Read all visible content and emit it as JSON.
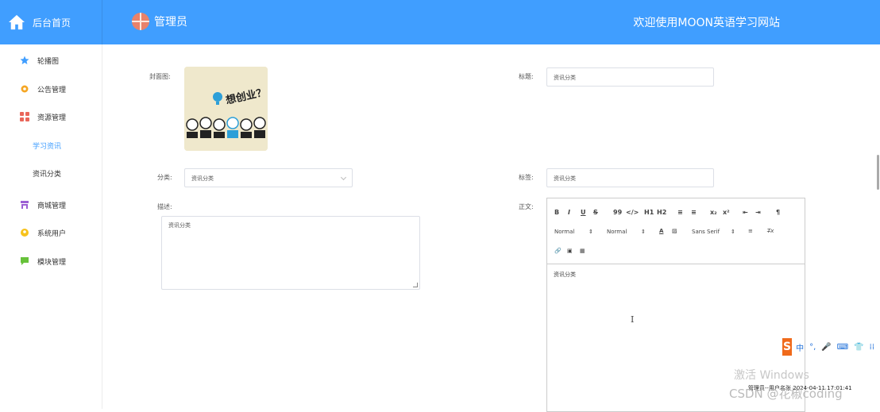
{
  "header": {
    "brand_label": "后台首页",
    "user_label": "管理员",
    "welcome_text": "欢迎使用MOON英语学习网站"
  },
  "sidebar": {
    "items": [
      {
        "label": "轮播图",
        "icon": "star-icon",
        "color": "#409eff"
      },
      {
        "label": "公告管理",
        "icon": "gear-icon",
        "color": "#f5a623"
      },
      {
        "label": "资源管理",
        "icon": "grid-icon",
        "color": "#e9665a"
      },
      {
        "label": "学习资讯",
        "icon": "",
        "color": "#409eff"
      },
      {
        "label": "资讯分类",
        "icon": "",
        "color": "#333333"
      },
      {
        "label": "商城管理",
        "icon": "shop-icon",
        "color": "#9c5fd4"
      },
      {
        "label": "系统用户",
        "icon": "user-icon",
        "color": "#f7c21b"
      },
      {
        "label": "模块管理",
        "icon": "chat-icon",
        "color": "#67c23a"
      }
    ]
  },
  "form": {
    "cover_label": "封面图:",
    "cover_image_text": "想创业？",
    "title_label": "标题:",
    "title_value": "资讯分类",
    "category_label": "分类:",
    "category_value": "资讯分类",
    "tags_label": "标签:",
    "tags_value": "资讯分类",
    "desc_label": "描述:",
    "desc_value": "资讯分类",
    "body_label": "正文:"
  },
  "editor": {
    "row1": [
      "B",
      "I",
      "U",
      "S",
      "99",
      "</>",
      "H1",
      "H2",
      "≡",
      "≡",
      "x₂",
      "x²",
      "⇤",
      "⇥",
      "¶"
    ],
    "header_select": "Normal",
    "size_select": "Normal",
    "font_select": "Sans Serif",
    "content": "资讯分类"
  },
  "overlays": {
    "ime_items": [
      "中",
      "°,",
      "🎤",
      "⌨",
      "👕",
      "⁞⁞"
    ],
    "activate_text": "激活 Windows",
    "status_text": "管理员--用户名张 2024-04-11 17:01:41",
    "csdn_text": "CSDN @花椒coding"
  }
}
